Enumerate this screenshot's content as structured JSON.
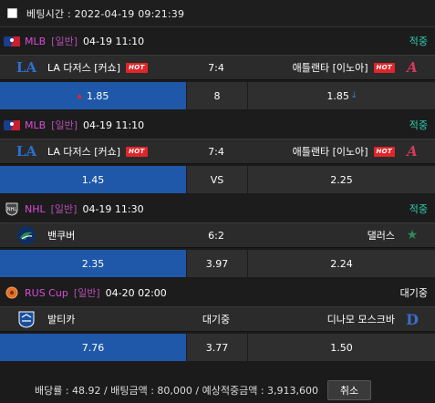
{
  "header": {
    "label": "베팅시간 : 2022-04-19 09:21:39"
  },
  "bets": [
    {
      "league": {
        "name": "MLB",
        "type": "[일반]",
        "time": "04-19 11:10",
        "status": "적중"
      },
      "home": {
        "name": "LA 다저스 [커쇼]",
        "hot": "HOT",
        "logo": "LA"
      },
      "score": "7:4",
      "away": {
        "name": "애틀랜타 [이노아]",
        "hot": "HOT",
        "logo": "A"
      },
      "odds": {
        "home": "1.85",
        "mid": "8",
        "away": "1.85"
      },
      "selected": "home"
    },
    {
      "league": {
        "name": "MLB",
        "type": "[일반]",
        "time": "04-19 11:10",
        "status": "적중"
      },
      "home": {
        "name": "LA 다저스 [커쇼]",
        "hot": "HOT",
        "logo": "LA"
      },
      "score": "7:4",
      "away": {
        "name": "애틀랜타 [이노아]",
        "hot": "HOT",
        "logo": "A"
      },
      "odds": {
        "home": "1.45",
        "mid": "VS",
        "away": "2.25"
      },
      "selected": "home"
    },
    {
      "league": {
        "name": "NHL",
        "type": "[일반]",
        "time": "04-19 11:30",
        "status": "적중"
      },
      "home": {
        "name": "밴쿠버",
        "logo": "V"
      },
      "score": "6:2",
      "away": {
        "name": "댈러스",
        "logo": "★"
      },
      "odds": {
        "home": "2.35",
        "mid": "3.97",
        "away": "2.24"
      },
      "selected": "home"
    },
    {
      "league": {
        "name": "RUS Cup",
        "type": "[일반]",
        "time": "04-20 02:00",
        "status": "대기중"
      },
      "home": {
        "name": "발티카",
        "logo": "B"
      },
      "score": "대기중",
      "away": {
        "name": "디나모 모스크바",
        "logo": "D"
      },
      "odds": {
        "home": "7.76",
        "mid": "3.77",
        "away": "1.50"
      },
      "selected": "home"
    }
  ],
  "footer": {
    "summary": "배당률 : 48.92 / 배팅금액 : 80,000 / 예상적중금액 : 3,913,600",
    "cancel": "취소"
  },
  "colors": {
    "background": "#1b1b1b",
    "selected_odds": "#1f58a8",
    "league_name": "#d94bd6",
    "status_hit": "#2fcfae",
    "hot_badge": "#e0262b"
  }
}
